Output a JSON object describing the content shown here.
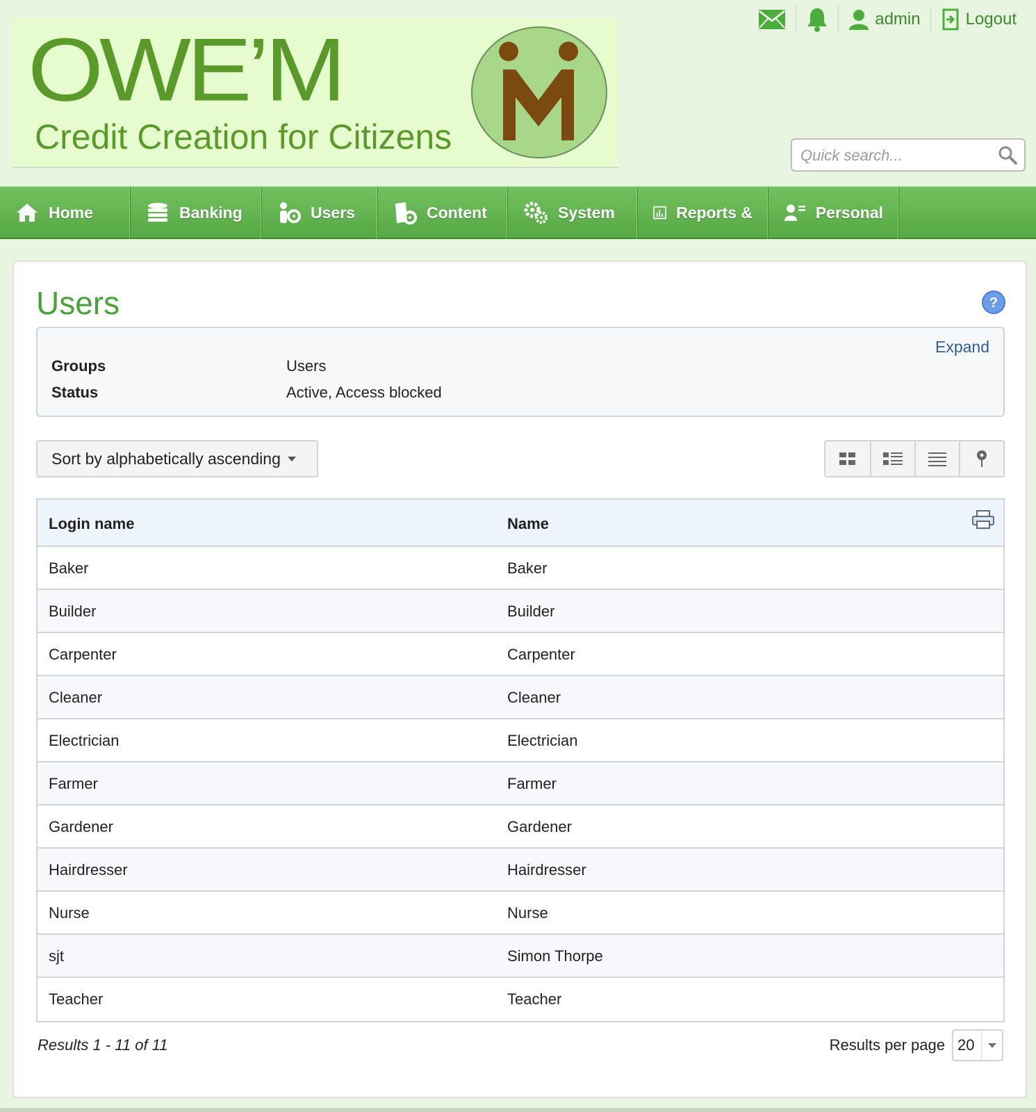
{
  "brand": {
    "logo_main": "OWE’M",
    "tagline": "Credit Creation for Citizens",
    "colors": {
      "logo": "#5a9a2a",
      "nav": "#5cb04a",
      "title": "#4aa33a",
      "link": "#2f5e9c"
    }
  },
  "toplinks": {
    "messages_icon": "envelope-icon",
    "notifications_icon": "bell-icon",
    "user_label": "admin",
    "logout_label": "Logout"
  },
  "search": {
    "placeholder": "Quick search..."
  },
  "nav": {
    "items": [
      {
        "label": "Home",
        "icon": "home-icon"
      },
      {
        "label": "Banking",
        "icon": "coins-icon"
      },
      {
        "label": "Users",
        "icon": "users-gear-icon"
      },
      {
        "label": "Content",
        "icon": "content-gear-icon"
      },
      {
        "label": "System",
        "icon": "gears-icon"
      },
      {
        "label": "Reports &",
        "icon": "chart-icon"
      },
      {
        "label": "Personal",
        "icon": "person-card-icon"
      }
    ]
  },
  "page": {
    "title": "Users"
  },
  "filters": {
    "expand_label": "Expand",
    "rows": [
      {
        "key": "Groups",
        "value": "Users"
      },
      {
        "key": "Status",
        "value": "Active, Access blocked"
      }
    ]
  },
  "sort": {
    "label": "Sort by alphabetically ascending"
  },
  "table": {
    "columns": [
      "Login name",
      "Name"
    ],
    "rows": [
      [
        "Baker",
        "Baker"
      ],
      [
        "Builder",
        "Builder"
      ],
      [
        "Carpenter",
        "Carpenter"
      ],
      [
        "Cleaner",
        "Cleaner"
      ],
      [
        "Electrician",
        "Electrician"
      ],
      [
        "Farmer",
        "Farmer"
      ],
      [
        "Gardener",
        "Gardener"
      ],
      [
        "Hairdresser",
        "Hairdresser"
      ],
      [
        "Nurse",
        "Nurse"
      ],
      [
        "sjt",
        "Simon Thorpe"
      ],
      [
        "Teacher",
        "Teacher"
      ]
    ]
  },
  "pagination": {
    "results_text": "Results 1 - 11 of 11",
    "per_page_label": "Results per page",
    "per_page_value": "20"
  }
}
